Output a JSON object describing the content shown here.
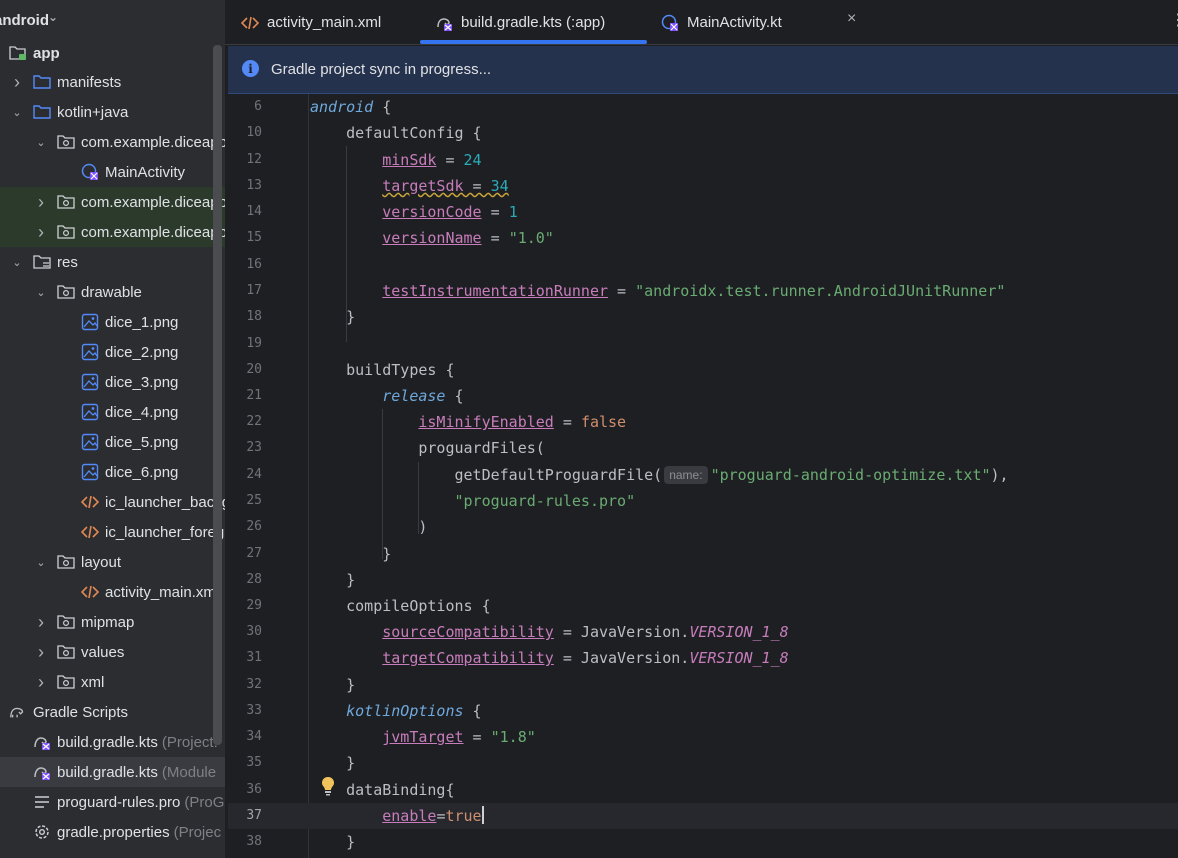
{
  "sidebar": {
    "title": "android",
    "items": [
      {
        "label": "app",
        "suffix": "",
        "icon": "module-folder-icon",
        "expand": "",
        "depth": 0
      },
      {
        "label": "manifests",
        "suffix": "",
        "icon": "folder-icon",
        "expand": "collapsed",
        "depth": 1
      },
      {
        "label": "kotlin+java",
        "suffix": "",
        "icon": "folder-icon",
        "expand": "expanded",
        "depth": 1
      },
      {
        "label": "com.example.diceapp",
        "suffix": "",
        "icon": "package-icon",
        "expand": "expanded",
        "depth": 2
      },
      {
        "label": "MainActivity",
        "suffix": "",
        "icon": "kotlin-class-icon",
        "expand": "",
        "depth": 3
      },
      {
        "label": "com.example.diceapp",
        "suffix": "",
        "icon": "package-icon",
        "expand": "collapsed",
        "depth": 2
      },
      {
        "label": "com.example.diceapp",
        "suffix": "",
        "icon": "package-icon",
        "expand": "collapsed",
        "depth": 2
      },
      {
        "label": "res",
        "suffix": "",
        "icon": "res-folder-icon",
        "expand": "expanded",
        "depth": 1
      },
      {
        "label": "drawable",
        "suffix": "",
        "icon": "package-icon",
        "expand": "expanded",
        "depth": 2
      },
      {
        "label": "dice_1.png",
        "suffix": "",
        "icon": "image-icon",
        "expand": "",
        "depth": 3
      },
      {
        "label": "dice_2.png",
        "suffix": "",
        "icon": "image-icon",
        "expand": "",
        "depth": 3
      },
      {
        "label": "dice_3.png",
        "suffix": "",
        "icon": "image-icon",
        "expand": "",
        "depth": 3
      },
      {
        "label": "dice_4.png",
        "suffix": "",
        "icon": "image-icon",
        "expand": "",
        "depth": 3
      },
      {
        "label": "dice_5.png",
        "suffix": "",
        "icon": "image-icon",
        "expand": "",
        "depth": 3
      },
      {
        "label": "dice_6.png",
        "suffix": "",
        "icon": "image-icon",
        "expand": "",
        "depth": 3
      },
      {
        "label": "ic_launcher_backg",
        "suffix": "",
        "icon": "xml-icon",
        "expand": "",
        "depth": 3
      },
      {
        "label": "ic_launcher_foreg",
        "suffix": "",
        "icon": "xml-icon",
        "expand": "",
        "depth": 3
      },
      {
        "label": "layout",
        "suffix": "",
        "icon": "package-icon",
        "expand": "expanded",
        "depth": 2
      },
      {
        "label": "activity_main.xml",
        "suffix": "",
        "icon": "xml-icon",
        "expand": "",
        "depth": 3
      },
      {
        "label": "mipmap",
        "suffix": "",
        "icon": "package-icon",
        "expand": "collapsed",
        "depth": 2
      },
      {
        "label": "values",
        "suffix": "",
        "icon": "package-icon",
        "expand": "collapsed",
        "depth": 2
      },
      {
        "label": "xml",
        "suffix": "",
        "icon": "package-icon",
        "expand": "collapsed",
        "depth": 2
      },
      {
        "label": "Gradle Scripts",
        "suffix": "",
        "icon": "gradle-icon",
        "expand": "",
        "depth": 0
      },
      {
        "label": "build.gradle.kts",
        "suffix": "(Project:",
        "icon": "gradle-kts-icon",
        "expand": "",
        "depth": 1
      },
      {
        "label": "build.gradle.kts",
        "suffix": "(Module",
        "icon": "gradle-kts-icon",
        "expand": "",
        "depth": 1
      },
      {
        "label": "proguard-rules.pro",
        "suffix": "(ProG",
        "icon": "text-file-icon",
        "expand": "",
        "depth": 1
      },
      {
        "label": "gradle.properties",
        "suffix": "(Projec",
        "icon": "settings-file-icon",
        "expand": "",
        "depth": 1
      }
    ]
  },
  "tabs": [
    {
      "label": "activity_main.xml",
      "icon": "xml-icon"
    },
    {
      "label": "build.gradle.kts (:app)",
      "icon": "gradle-kts-icon"
    },
    {
      "label": "MainActivity.kt",
      "icon": "kotlin-class-icon"
    }
  ],
  "tab_close_glyph": "×",
  "tab_more_glyph": "⋮",
  "banner": {
    "text": "Gradle project sync in progress..."
  },
  "hint_label": "name:",
  "colors": {
    "accent": "#3574f0",
    "banner_bg": "#25324d"
  }
}
